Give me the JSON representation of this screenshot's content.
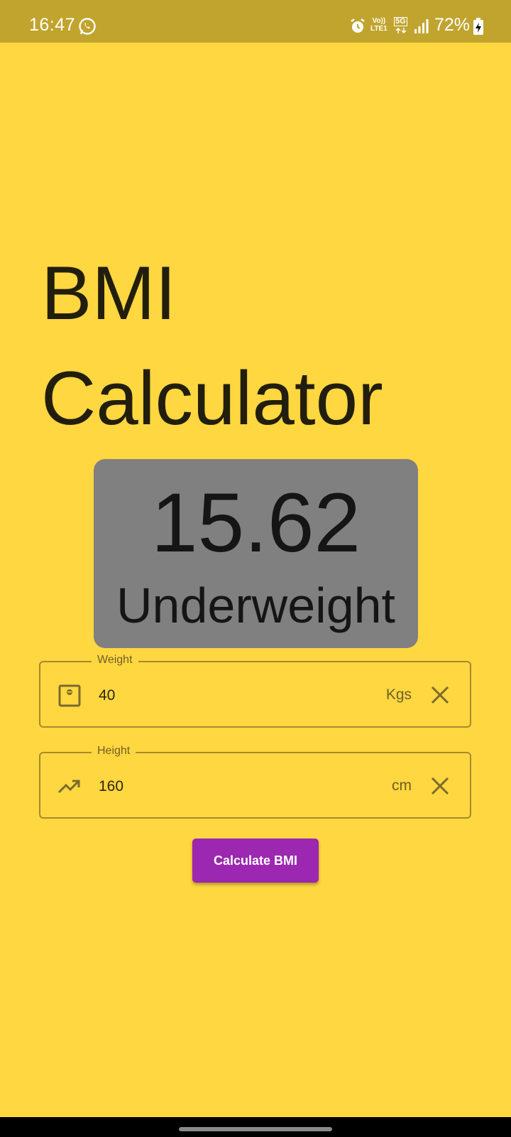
{
  "status_bar": {
    "time": "16:47",
    "volte_line1": "Vo))",
    "volte_line2": "LTE1",
    "network": "5G",
    "battery": "72%",
    "icons": [
      "whatsapp-icon",
      "alarm-icon",
      "signal-icon",
      "battery-charging-icon"
    ]
  },
  "app": {
    "title_line1": "BMI",
    "title_line2": "Calculator",
    "background_color": "#FFD740"
  },
  "result": {
    "value": "15.62",
    "category": "Underweight",
    "card_color": "#808080"
  },
  "weight_field": {
    "label": "Weight",
    "value": "40",
    "suffix": "Kgs",
    "icon": "scale-icon"
  },
  "height_field": {
    "label": "Height",
    "value": "160",
    "suffix": "cm",
    "icon": "trending-up-icon"
  },
  "calculate_button": {
    "label": "Calculate BMI",
    "color": "#9C27B0"
  }
}
